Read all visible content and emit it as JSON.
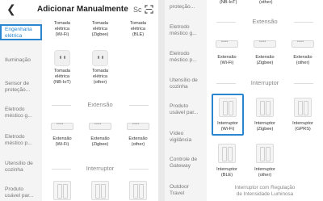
{
  "header": {
    "title": "Adicionar Manualmente",
    "scan_text": "Sc",
    "back_icon": "chevron-left-icon",
    "scan_icon": "scan-icon"
  },
  "left_panel": {
    "sidebar": [
      "Engenharia elétrica",
      "Iluminação",
      "Sensor de proteção...",
      "Eletrodo méstico g...",
      "Eletrodo méstico p...",
      "Utensílio de cozinha",
      "Produto usável par..."
    ],
    "row1": [
      {
        "line1": "Tomada",
        "line2": "elétrica",
        "line3": "(Wi-Fi)"
      },
      {
        "line1": "Tomada",
        "line2": "elétrica",
        "line3": "(Zigbee)"
      },
      {
        "line1": "Tomada",
        "line2": "elétrica",
        "line3": "(BLE)"
      }
    ],
    "row2": [
      {
        "line1": "Tomada",
        "line2": "elétrica",
        "line3": "(NB-IoT)"
      },
      {
        "line1": "Tomada",
        "line2": "elétrica",
        "line3": "(other)"
      }
    ],
    "extensao_header": "Extensão",
    "extensao": [
      {
        "line1": "Extensão",
        "line2": "(Wi-Fi)"
      },
      {
        "line1": "Extensão",
        "line2": "(Zigbee)"
      },
      {
        "line1": "Extensão",
        "line2": "(other)"
      }
    ],
    "interruptor_header": "Interruptor"
  },
  "right_panel": {
    "sidebar": [
      "proteção...",
      "Eletrodo méstico g...",
      "Eletrodo méstico p...",
      "Utensílio de cozinha",
      "Produto usável par...",
      "Vídeo vigilância",
      "Controle de Gateway",
      "Outdoor Travel"
    ],
    "top_partial": [
      "(NB-IoT)",
      "(other)"
    ],
    "extensao_header": "Extensão",
    "extensao": [
      {
        "line1": "Extensão",
        "line2": "(Wi-Fi)"
      },
      {
        "line1": "Extensão",
        "line2": "(Zigbee)"
      },
      {
        "line1": "Extensão",
        "line2": "(other)"
      }
    ],
    "interruptor_header": "Interruptor",
    "interruptor_row1": [
      {
        "line1": "Interruptor",
        "line2": "(Wi-Fi)"
      },
      {
        "line1": "Interruptor",
        "line2": "(Zigbee)"
      },
      {
        "line1": "Interruptor",
        "line2": "(GPRS)"
      }
    ],
    "interruptor_row2": [
      {
        "line1": "Interruptor",
        "line2": "(BLE)"
      },
      {
        "line1": "Interruptor",
        "line2": "(other)"
      }
    ],
    "sub_header_line1": "Interruptor com Regulação",
    "sub_header_line2": "de Intensidade Luminosa"
  },
  "colors": {
    "accent": "#2a86d1",
    "sidebar_bg": "#f4f4f4"
  }
}
